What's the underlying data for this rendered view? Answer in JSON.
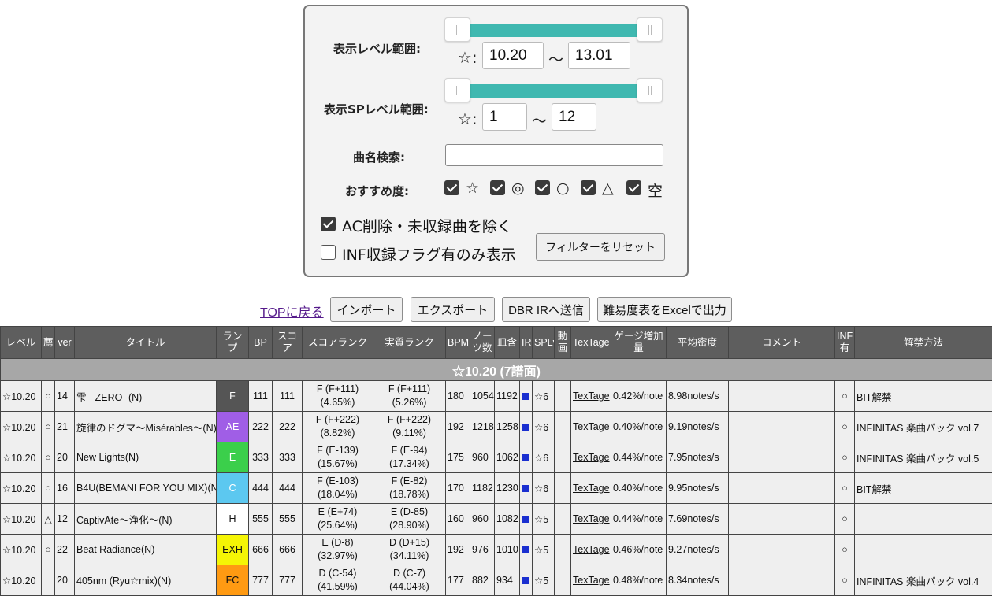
{
  "filters": {
    "level_range_label": "表示レベル範囲:",
    "level_min": "10.20",
    "level_max": "13.01",
    "sp_range_label": "表示SPレベル範囲:",
    "sp_min": "1",
    "sp_max": "12",
    "star_prefix": "☆:",
    "tilde": "～",
    "search_label": "曲名検索:",
    "search_placeholder": "",
    "recommend_label": "おすすめ度:",
    "recommend_options": [
      "☆",
      "◎",
      "○",
      "△",
      "空"
    ],
    "exclude_ac_label": "AC削除・未収録曲を除く",
    "exclude_ac_checked": true,
    "inf_only_label": "INF収録フラグ有のみ表示",
    "inf_only_checked": false,
    "reset_button": "フィルターをリセット"
  },
  "toolbar": {
    "top_link": "TOPに戻る",
    "import": "インポート",
    "export": "エクスポート",
    "dbr_ir": "DBR IRへ送信",
    "excel": "難易度表をExcelで出力"
  },
  "table": {
    "headers": {
      "level": "レベル",
      "rec": "薦",
      "ver": "ver",
      "title": "タイトル",
      "lamp": "ランプ",
      "bp": "BP",
      "score": "スコア",
      "score_rank": "スコアランク",
      "real_rank": "実質ランク",
      "bpm": "BPM",
      "notes": "ノーツ数",
      "plate": "皿含",
      "ir": "IR",
      "splv": "SPLv",
      "video": "動画",
      "textage": "TexTage",
      "gauge": "ゲージ増加量",
      "density": "平均密度",
      "comment": "コメント",
      "inf": "INF有",
      "unlock": "解禁方法"
    },
    "group_label": "☆10.20 (7譜面)",
    "rows": [
      {
        "level": "☆10.20",
        "rec": "○",
        "ver": "14",
        "title": "雫 - ZERO -(N)",
        "lamp": "F",
        "lamp_color": "#555555",
        "lamp_text_color": "#ffffff",
        "bp": "111",
        "score": "111",
        "score_rank_1": "F (F+111)",
        "score_rank_2": "(4.65%)",
        "real_rank_1": "F (F+111)",
        "real_rank_2": "(5.26%)",
        "bpm": "180",
        "notes": "1054",
        "plate": "1192",
        "splv": "☆6",
        "textage": "TexTage",
        "gauge": "0.42%/note",
        "density": "8.98notes/s",
        "comment": "",
        "inf": "○",
        "unlock": "BIT解禁"
      },
      {
        "level": "☆10.20",
        "rec": "○",
        "ver": "21",
        "title": "旋律のドグマ～Misérables～(N)",
        "lamp": "AE",
        "lamp_color": "#a05ee6",
        "lamp_text_color": "#ffffff",
        "bp": "222",
        "score": "222",
        "score_rank_1": "F (F+222)",
        "score_rank_2": "(8.82%)",
        "real_rank_1": "F (F+222)",
        "real_rank_2": "(9.11%)",
        "bpm": "192",
        "notes": "1218",
        "plate": "1258",
        "splv": "☆6",
        "textage": "TexTage",
        "gauge": "0.40%/note",
        "density": "9.19notes/s",
        "comment": "",
        "inf": "○",
        "unlock": "INFINITAS 楽曲パック vol.7"
      },
      {
        "level": "☆10.20",
        "rec": "○",
        "ver": "20",
        "title": "New Lights(N)",
        "lamp": "E",
        "lamp_color": "#3bcf4b",
        "lamp_text_color": "#ffffff",
        "bp": "333",
        "score": "333",
        "score_rank_1": "F (E-139)",
        "score_rank_2": "(15.67%)",
        "real_rank_1": "F (E-94)",
        "real_rank_2": "(17.34%)",
        "bpm": "175",
        "notes": "960",
        "plate": "1062",
        "splv": "☆6",
        "textage": "TexTage",
        "gauge": "0.44%/note",
        "density": "7.95notes/s",
        "comment": "",
        "inf": "○",
        "unlock": "INFINITAS 楽曲パック vol.5"
      },
      {
        "level": "☆10.20",
        "rec": "○",
        "ver": "16",
        "title": "B4U(BEMANI FOR YOU MIX)(N)",
        "lamp": "C",
        "lamp_color": "#5cc8f0",
        "lamp_text_color": "#ffffff",
        "bp": "444",
        "score": "444",
        "score_rank_1": "F (E-103)",
        "score_rank_2": "(18.04%)",
        "real_rank_1": "F (E-82)",
        "real_rank_2": "(18.78%)",
        "bpm": "170",
        "notes": "1182",
        "plate": "1230",
        "splv": "☆6",
        "textage": "TexTage",
        "gauge": "0.40%/note",
        "density": "9.95notes/s",
        "comment": "",
        "inf": "○",
        "unlock": "BIT解禁"
      },
      {
        "level": "☆10.20",
        "rec": "△",
        "ver": "12",
        "title": "CaptivAte～浄化～(N)",
        "lamp": "H",
        "lamp_color": "#ffffff",
        "lamp_text_color": "#111111",
        "bp": "555",
        "score": "555",
        "score_rank_1": "E (E+74)",
        "score_rank_2": "(25.64%)",
        "real_rank_1": "E (D-85)",
        "real_rank_2": "(28.90%)",
        "bpm": "160",
        "notes": "960",
        "plate": "1082",
        "splv": "☆5",
        "textage": "TexTage",
        "gauge": "0.44%/note",
        "density": "7.69notes/s",
        "comment": "",
        "inf": "○",
        "unlock": ""
      },
      {
        "level": "☆10.20",
        "rec": "○",
        "ver": "22",
        "title": "Beat Radiance(N)",
        "lamp": "EXH",
        "lamp_color": "#f5f505",
        "lamp_text_color": "#111111",
        "bp": "666",
        "score": "666",
        "score_rank_1": "E (D-8)",
        "score_rank_2": "(32.97%)",
        "real_rank_1": "D (D+15)",
        "real_rank_2": "(34.11%)",
        "bpm": "192",
        "notes": "976",
        "plate": "1010",
        "splv": "☆5",
        "textage": "TexTage",
        "gauge": "0.46%/note",
        "density": "9.27notes/s",
        "comment": "",
        "inf": "○",
        "unlock": ""
      },
      {
        "level": "☆10.20",
        "rec": "",
        "ver": "20",
        "title": "405nm (Ryu☆mix)(N)",
        "lamp": "FC",
        "lamp_color": "#ff9a12",
        "lamp_text_color": "#111111",
        "bp": "777",
        "score": "777",
        "score_rank_1": "D (C-54)",
        "score_rank_2": "(41.59%)",
        "real_rank_1": "D (C-7)",
        "real_rank_2": "(44.04%)",
        "bpm": "177",
        "notes": "882",
        "plate": "934",
        "splv": "☆5",
        "textage": "TexTage",
        "gauge": "0.48%/note",
        "density": "8.34notes/s",
        "comment": "",
        "inf": "○",
        "unlock": "INFINITAS 楽曲パック vol.4"
      }
    ]
  }
}
